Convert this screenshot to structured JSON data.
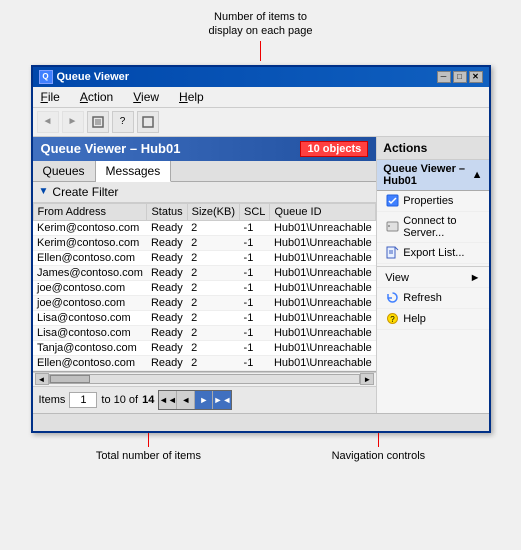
{
  "annotations": {
    "top": "Number of items to\ndisplay on each page"
  },
  "window": {
    "title": "Queue Viewer",
    "min_btn": "─",
    "max_btn": "□",
    "close_btn": "✕"
  },
  "menu": {
    "items": [
      "File",
      "Action",
      "View",
      "Help"
    ]
  },
  "toolbar": {
    "buttons": [
      "◄",
      "►",
      "☐",
      "?",
      "☐"
    ]
  },
  "pane_header": {
    "title": "Queue Viewer – Hub01",
    "badge": "10 objects"
  },
  "tabs": {
    "items": [
      "Queues",
      "Messages"
    ],
    "active": "Messages"
  },
  "filter": {
    "label": "Create Filter"
  },
  "table": {
    "columns": [
      "From Address",
      "Status",
      "Size(KB)",
      "SCL",
      "Queue ID"
    ],
    "rows": [
      [
        "Kerim@contoso.com",
        "Ready",
        "2",
        "-1",
        "Hub01\\Unreachable"
      ],
      [
        "Kerim@contoso.com",
        "Ready",
        "2",
        "-1",
        "Hub01\\Unreachable"
      ],
      [
        "Ellen@contoso.com",
        "Ready",
        "2",
        "-1",
        "Hub01\\Unreachable"
      ],
      [
        "James@contoso.com",
        "Ready",
        "2",
        "-1",
        "Hub01\\Unreachable"
      ],
      [
        "joe@contoso.com",
        "Ready",
        "2",
        "-1",
        "Hub01\\Unreachable"
      ],
      [
        "joe@contoso.com",
        "Ready",
        "2",
        "-1",
        "Hub01\\Unreachable"
      ],
      [
        "Lisa@contoso.com",
        "Ready",
        "2",
        "-1",
        "Hub01\\Unreachable"
      ],
      [
        "Lisa@contoso.com",
        "Ready",
        "2",
        "-1",
        "Hub01\\Unreachable"
      ],
      [
        "Tanja@contoso.com",
        "Ready",
        "2",
        "-1",
        "Hub01\\Unreachable"
      ],
      [
        "Ellen@contoso.com",
        "Ready",
        "2",
        "-1",
        "Hub01\\Unreachable"
      ]
    ]
  },
  "pagination": {
    "items_label": "Items",
    "current_page": "1",
    "page_info": "to 10 of",
    "total": "14",
    "nav_buttons": [
      "◄◄",
      "◄",
      "►",
      "►►"
    ]
  },
  "actions_panel": {
    "header": "Actions",
    "section_title": "Queue Viewer – Hub01",
    "items": [
      {
        "label": "Properties",
        "icon": "check"
      },
      {
        "label": "Connect to Server...",
        "icon": "server"
      },
      {
        "label": "Export List...",
        "icon": "export"
      },
      {
        "label": "View",
        "icon": "",
        "has_arrow": true
      },
      {
        "label": "Refresh",
        "icon": "refresh"
      },
      {
        "label": "Help",
        "icon": "help"
      }
    ]
  },
  "bottom_annotations": {
    "total_label": "Total number of items",
    "nav_label": "Navigation controls"
  }
}
